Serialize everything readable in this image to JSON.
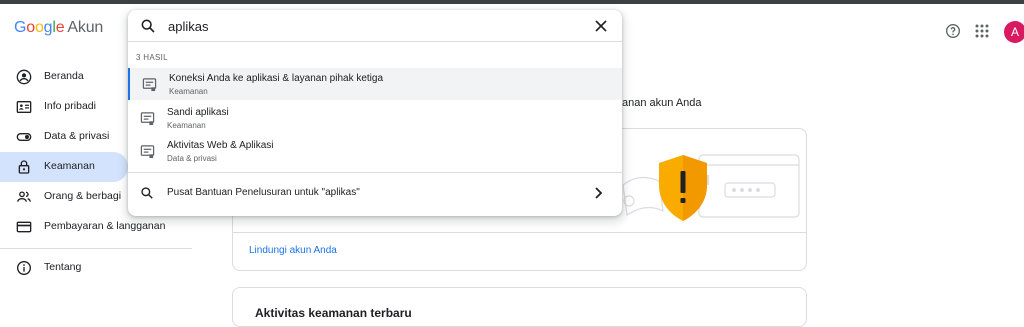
{
  "header": {
    "logo_google": [
      "G",
      "o",
      "o",
      "g",
      "l",
      "e"
    ],
    "logo_product": "Akun",
    "avatar_letter": "A",
    "help_icon": "help-circle-icon",
    "apps_icon": "apps-grid-icon"
  },
  "search": {
    "value": "aplikas",
    "hits_label": "3 HASIL",
    "results": [
      {
        "title": "Koneksi Anda ke aplikasi & layanan pihak ketiga",
        "category": "Keamanan",
        "icon": "settings-doc-icon"
      },
      {
        "title": "Sandi aplikasi",
        "category": "Keamanan",
        "icon": "settings-doc-icon"
      },
      {
        "title": "Aktivitas Web & Aplikasi",
        "category": "Data & privasi",
        "icon": "settings-doc-icon"
      }
    ],
    "help_search_label": "Pusat Bantuan Penelusuran untuk \"aplikas\""
  },
  "sidebar": {
    "items": [
      {
        "label": "Beranda",
        "icon": "account-circle-icon"
      },
      {
        "label": "Info pribadi",
        "icon": "id-card-icon"
      },
      {
        "label": "Data & privasi",
        "icon": "toggle-icon"
      },
      {
        "label": "Keamanan",
        "icon": "lock-icon"
      },
      {
        "label": "Orang & berbagi",
        "icon": "people-icon"
      },
      {
        "label": "Pembayaran & langganan",
        "icon": "credit-card-icon"
      },
      {
        "label": "Tentang",
        "icon": "info-icon"
      }
    ],
    "active_index": 3
  },
  "main": {
    "subtitle_fragment": "anan akun Anda",
    "card_link": "Lindungi akun Anda",
    "card2_fragment": "Aktivitas keamanan terbaru"
  },
  "colors": {
    "accent": "#1a73e8",
    "active_nav_bg": "#d3e3fd",
    "avatar_bg": "#d81b60",
    "shield": "#f9ab00"
  }
}
